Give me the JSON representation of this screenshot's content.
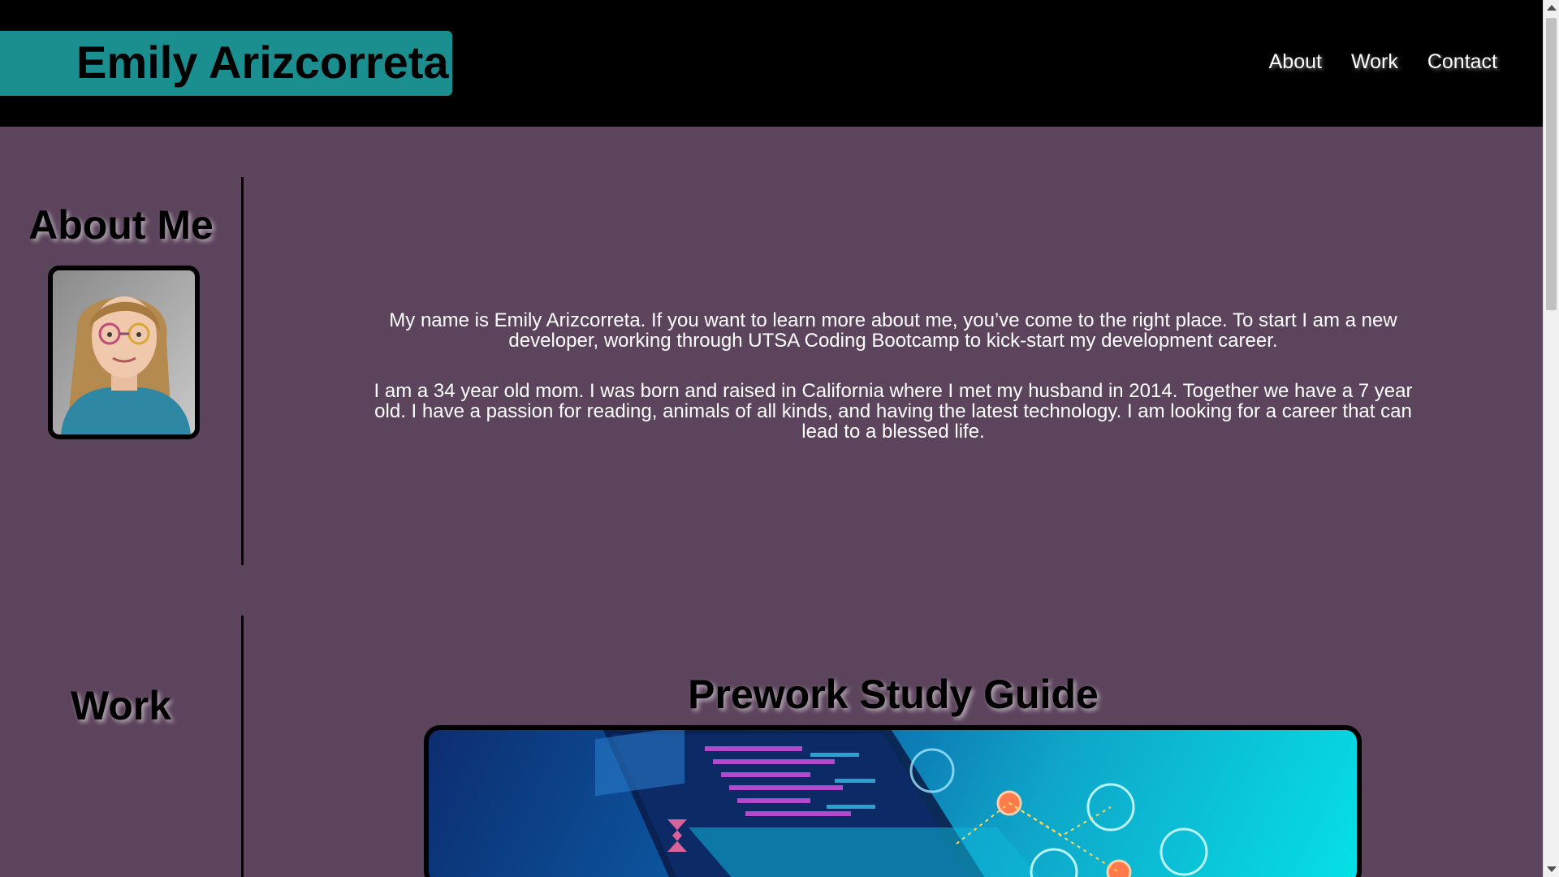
{
  "header": {
    "name": "Emily Arizcorreta",
    "nav": [
      "About",
      "Work",
      "Contact"
    ]
  },
  "about": {
    "heading": "About Me",
    "avatar_alt": "profile-photo",
    "paragraphs": [
      "My name is Emily Arizcorreta. If you want to learn more about me, you’ve come to the right place. To start I am a new developer, working through UTSA Coding Bootcamp to kick-start my development career.",
      "I am a 34 year old mom. I was born and raised in California where I met my husband in 2014. Together we have a 7 year old. I have a passion for reading, animals of all kinds, and having the latest technology. I am looking for a career that can lead to a blessed life."
    ]
  },
  "work": {
    "heading": "Work",
    "project_title": "Prework Study Guide"
  },
  "colors": {
    "header_bg": "#000000",
    "name_box": "#1b8e90",
    "page_bg": "#5c445c"
  }
}
